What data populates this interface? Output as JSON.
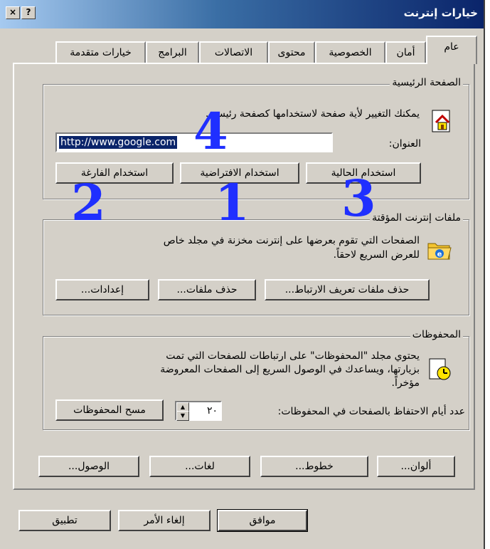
{
  "window": {
    "title": "خيارات إنترنت",
    "close_label": "×",
    "help_label": "?"
  },
  "tabs": [
    {
      "label": "عام"
    },
    {
      "label": "أمان"
    },
    {
      "label": "الخصوصية"
    },
    {
      "label": "محتوى"
    },
    {
      "label": "الاتصالات"
    },
    {
      "label": "البرامج"
    },
    {
      "label": "خيارات متقدمة"
    }
  ],
  "home": {
    "group_label": "الصفحة الرئيسية",
    "desc": "يمكنك التغيير لأية صفحة لاستخدامها كصفحة رئيسية.",
    "address_label": "العنوان:",
    "address_value": "http://www.google.com",
    "btn_current": "استخدام الحالية",
    "btn_default": "استخدام الافتراضية",
    "btn_blank": "استخدام الفارغة",
    "icon": "home-page-icon"
  },
  "temp": {
    "group_label": "ملفات إنترنت المؤقتة",
    "desc_line1": "الصفحات التي تقوم بعرضها على إنترنت مخزنة في مجلد خاص",
    "desc_line2": "للعرض السريع لاحقاً.",
    "btn_delete_cookies": "حذف ملفات تعريف الارتباط...",
    "btn_delete_files": "حذف ملفات...",
    "btn_settings": "إعدادات...",
    "icon": "temp-folder-icon"
  },
  "history": {
    "group_label": "المحفوظات",
    "desc_line1": "يحتوي مجلد \"المحفوظات\" على ارتباطات للصفحات التي تمت",
    "desc_line2": "بزيارتها، ويساعدك في الوصول السريع إلى الصفحات المعروضة",
    "desc_line3": "مؤخراً.",
    "days_label": "عدد أيام الاحتفاظ بالصفحات في المحفوظات:",
    "days_value": "٢٠",
    "btn_clear": "مسح المحفوظات",
    "icon": "history-icon"
  },
  "bottom_buttons": {
    "colors": "ألوان...",
    "fonts": "خطوط...",
    "languages": "لغات...",
    "accessibility": "الوصول..."
  },
  "dialog_buttons": {
    "ok": "موافق",
    "cancel": "إلغاء الأمر",
    "apply": "تطبيق"
  },
  "annotations": {
    "n1": "1",
    "n2": "2",
    "n3": "3",
    "n4": "4"
  },
  "colors": {
    "title_dark": "#0a246a",
    "annotation": "#1f2fff",
    "face": "#d4d0c8",
    "selection": "#0a246a"
  }
}
